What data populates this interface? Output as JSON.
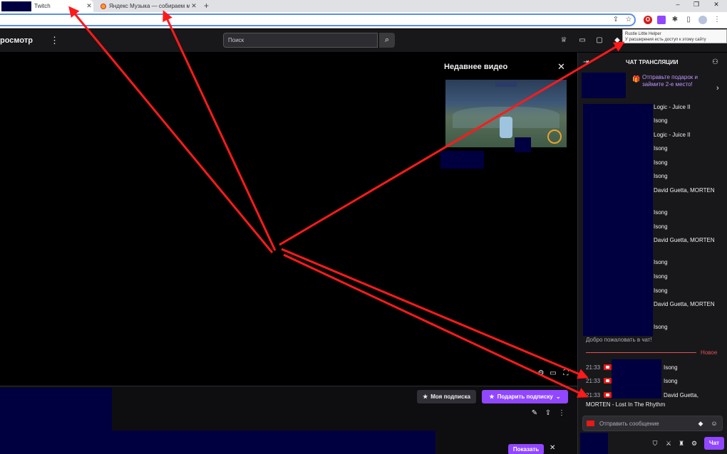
{
  "browser": {
    "tabs": [
      {
        "label": "Twitch",
        "close": "✕"
      },
      {
        "label": "Яндекс Музыка — собираем м...",
        "close": "✕"
      }
    ],
    "new_tab": "+",
    "window_controls": [
      "–",
      "❐",
      "✕"
    ]
  },
  "extension_tooltip": {
    "title": "Rustle Little Helper",
    "subtitle": "У расширения есть доступ к этому сайту"
  },
  "topnav": {
    "brand_partial": "росмотр",
    "search_placeholder": "Поиск"
  },
  "player": {
    "recent_videos_title": "Недавнее видео",
    "close": "✕"
  },
  "below_player": {
    "my_sub_label": "Моя подписка",
    "gift_sub_label": "Подарить подписку",
    "show_label": "Показать",
    "show_close": "✕"
  },
  "chat": {
    "title": "ЧАТ ТРАНСЛЯЦИИ",
    "promo_text": "Отправьте подарок и займите 2-е место!",
    "messages": [
      "Logic - Juice II",
      "Isong",
      "Logic - Juice II",
      "Isong",
      "Isong",
      "Isong",
      "David Guetta, MORTEN",
      "Isong",
      "Isong",
      "David Guetta, MORTEN",
      "Isong",
      "Isong",
      "Isong",
      "David Guetta, MORTEN",
      "Isong"
    ],
    "welcome": "Добро пожаловать в чат!",
    "new_label": "Новое",
    "new_messages": [
      {
        "time": "21:33",
        "text": "Isong"
      },
      {
        "time": "21:33",
        "text": "Isong"
      },
      {
        "time": "21:33",
        "text": "David Guetta,"
      }
    ],
    "wrap_line": "MORTEN - Lost In The Rhythm",
    "input_placeholder": "Отправить сообщение",
    "chat_button": "Чат"
  },
  "colors": {
    "accent": "#9147ff",
    "background": "#18181b",
    "redaction": "#000040",
    "annotation": "#ff0000"
  }
}
